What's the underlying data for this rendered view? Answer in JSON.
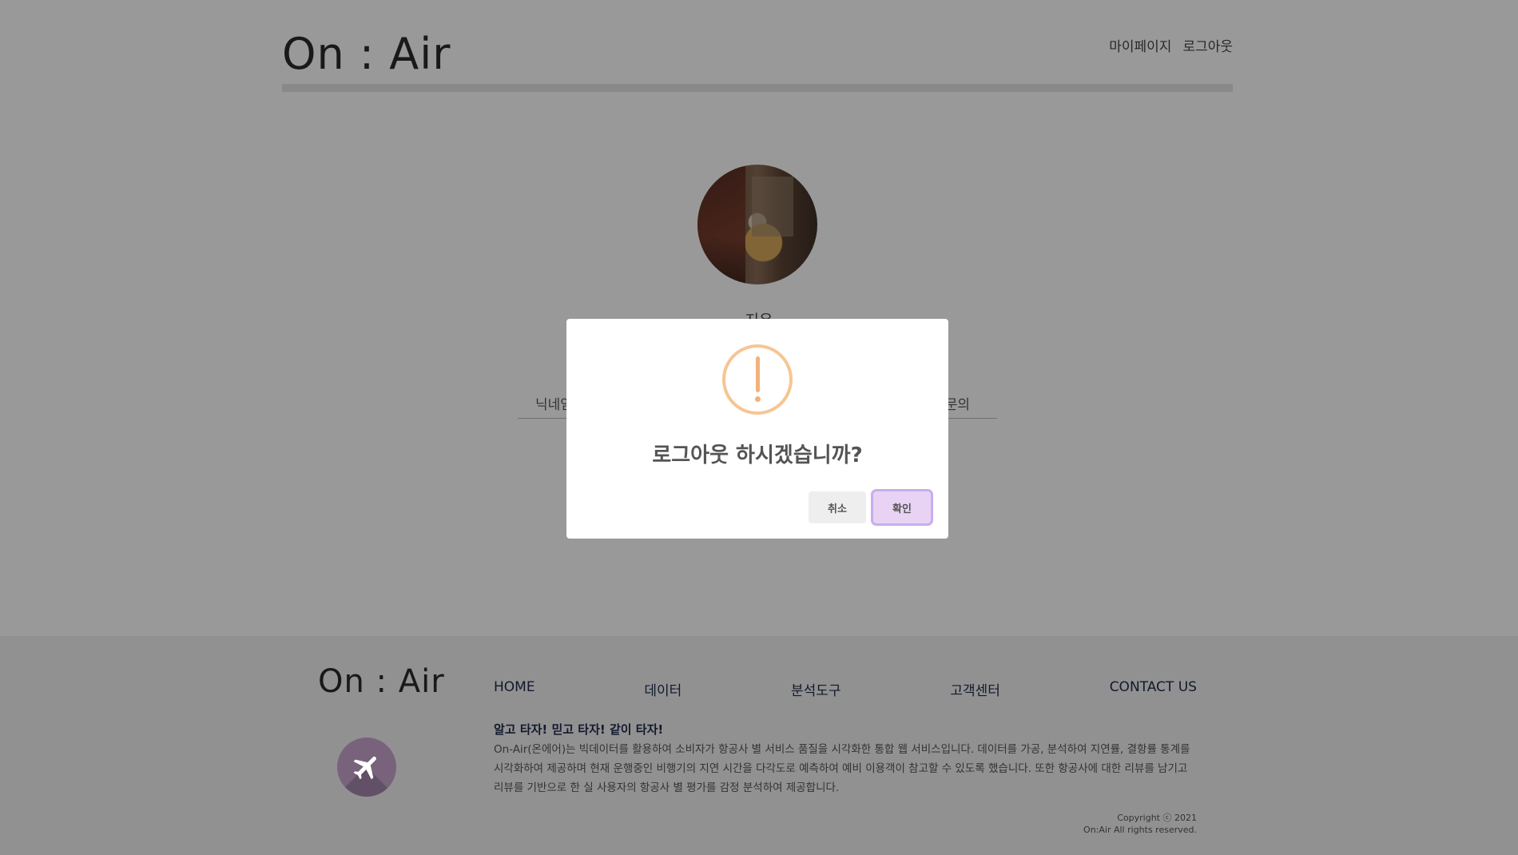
{
  "header": {
    "logo": "On : Air",
    "nav": {
      "mypage": "마이페이지",
      "logout": "로그아웃"
    }
  },
  "profile": {
    "name": "지유",
    "tabs": {
      "nickname": "닉네임",
      "inquiry": "문의"
    }
  },
  "modal": {
    "icon": "exclamation-icon",
    "title": "로그아웃 하시겠습니까?",
    "cancel_label": "취소",
    "confirm_label": "확인",
    "colors": {
      "icon": "#f7c593",
      "confirm_bg": "#e8d3f4",
      "confirm_ring": "#c6aef0"
    }
  },
  "footer": {
    "logo": "On : Air",
    "badge_icon": "airplane-icon",
    "nav": [
      "HOME",
      "데이터",
      "분석도구",
      "고객센터",
      "CONTACT US"
    ],
    "tagline": "알고 타자! 믿고 타자! 같이 타자!",
    "description": "On-Air(온에어)는 빅데이터를 활용하여 소비자가 항공사 별 서비스 품질을 시각화한 통합 웹 서비스입니다. 데이터를 가공, 분석하여 지연률, 결항률 통계를 시각화하여 제공하며 현재 운행중인 비행기의 지연 시간을 다각도로 예측하여 예비 이용객이 참고할 수 있도록 했습니다. 또한 항공사에 대한 리뷰를 남기고 리뷰를 기반으로 한 실 사용자의 항공사 별 평가를 감정 분석하여 제공합니다.",
    "copyright_line1": "Copyright ⓒ 2021",
    "copyright_line2": "On:Air All rights reserved."
  }
}
